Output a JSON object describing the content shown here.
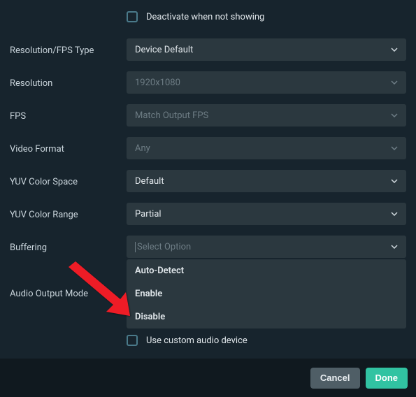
{
  "checkbox_top": {
    "label": "Deactivate when not showing"
  },
  "rows": {
    "res_fps_type": {
      "label": "Resolution/FPS Type",
      "value": "Device Default"
    },
    "resolution": {
      "label": "Resolution",
      "value": "1920x1080"
    },
    "fps": {
      "label": "FPS",
      "value": "Match Output FPS"
    },
    "video_format": {
      "label": "Video Format",
      "value": "Any"
    },
    "color_space": {
      "label": "YUV Color Space",
      "value": "Default"
    },
    "color_range": {
      "label": "YUV Color Range",
      "value": "Partial"
    },
    "buffering": {
      "label": "Buffering",
      "placeholder": "Select Option"
    },
    "audio_mode": {
      "label": "Audio Output Mode"
    }
  },
  "buffering_options": {
    "opt0": "Auto-Detect",
    "opt1": "Enable",
    "opt2": "Disable"
  },
  "checkbox_bottom": {
    "label": "Use custom audio device"
  },
  "footer": {
    "cancel": "Cancel",
    "done": "Done"
  },
  "colors": {
    "accent": "#31c3a2",
    "arrow": "#ee1c25"
  }
}
